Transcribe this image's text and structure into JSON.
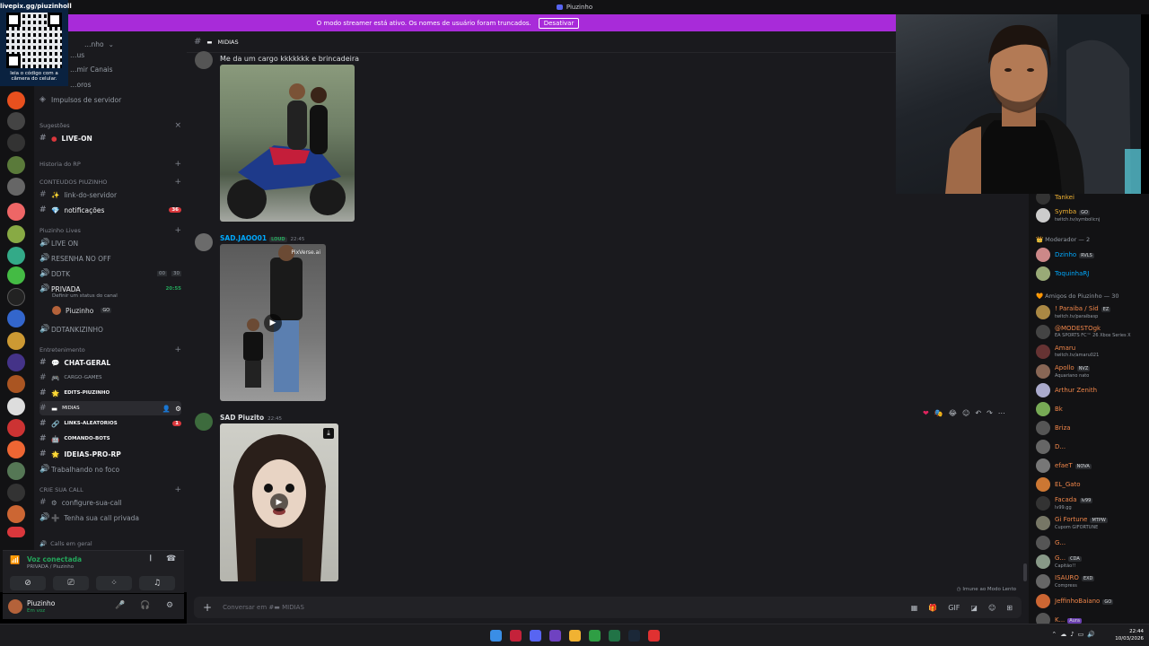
{
  "window": {
    "title": "Piuzinho"
  },
  "banner": {
    "text": "O modo streamer está ativo. Os nomes de usuário foram truncados.",
    "button": "Desativar"
  },
  "qr": {
    "url": "livepix.gg/piuzinholl",
    "caption": "leia o código com a câmera do celular."
  },
  "server": {
    "name": "…nho"
  },
  "channels": {
    "top_items": [
      "…us",
      "…mir Canais",
      "…oros",
      "Impulsos de servidor"
    ],
    "suggestions_label": "Sugestões",
    "live_on": "LIVE-ON",
    "cat_historia": "Historia do RP",
    "cat_conteudos": "CONTEUDOS PIUZINHO",
    "link_servidor": "link-do-servidor",
    "notificacoes": "notificações",
    "notif_badge": "36",
    "cat_lives": "Piuzinho Lives",
    "live_on_voice": "LIVE ON",
    "resenha": "RESENHA NO OFF",
    "ddtk": "DDTK",
    "ddtk_counts": [
      "00",
      "30"
    ],
    "privada": "PRIVADA",
    "privada_time": "20:55",
    "privada_status": "Definir um status do canal",
    "privada_user": "Piuzinho",
    "privada_user_tag": "GO",
    "ddtankzinho": "DDTANKIZINHO",
    "cat_entretenimento": "Entretenimento",
    "chat_geral": "CHAT-GERAL",
    "cargo_games": "CARGO-GAMES",
    "edits": "EDITS-PIUZINHO",
    "midias": "MIDIAS",
    "links": "LINKS-ALEATORIOS",
    "links_badge": "1",
    "comando": "COMANDO-BOTS",
    "ideias": "IDEIAS-PRO-RP",
    "trabalhando": "Trabalhando no foco",
    "cat_call": "CRIE SUA CALL",
    "configure": "configure-sua-call",
    "tenha": "Tenha sua call privada",
    "calls_geral": "Calls em geral"
  },
  "voice": {
    "status": "Voz conectada",
    "channel": "PRIVADA / Piuzinho"
  },
  "user": {
    "name": "Piuzinho",
    "status": "Em voz"
  },
  "header": {
    "channel": "MIDIAS"
  },
  "messages": [
    {
      "text": "Me da um cargo kkkkkkk e brincadeira"
    },
    {
      "author": "SAD.JAOO01",
      "tag": "LOUD",
      "time": "22:45",
      "watermark": "PixVerse.ai"
    },
    {
      "author": "SAD Piuzito",
      "time": "22:45"
    }
  ],
  "composer": {
    "placeholder": "Conversar em #",
    "channel": "MIDIAS"
  },
  "slowmode": "Imune ao Modo Lento",
  "members": {
    "top": [
      {
        "name": "Tankei",
        "color": "#f0b232"
      },
      {
        "name": "Symba",
        "tag": "GO",
        "sub": "twitch.tv/symbolicnj",
        "color": "#f0b232"
      }
    ],
    "mod_header": "Moderador — 2",
    "mods": [
      {
        "name": "Dzinho",
        "tag": "RVLS",
        "color": "#00a8fc"
      },
      {
        "name": "ToquinhaRJ",
        "color": "#00a8fc"
      }
    ],
    "friends_header": "Amigos do Piuzinho — 30",
    "friends": [
      {
        "name": "! Paraiba / Sid",
        "tag": "EZ",
        "sub": "twitch.tv/paraibasp"
      },
      {
        "name": "@MODESTOgk",
        "sub": "EA SPORTS FC™ 26 Xbox Series X"
      },
      {
        "name": "Amaru",
        "sub": "twitch.tv/amaru021"
      },
      {
        "name": "Apollo",
        "tag": "NVZ",
        "sub": "Aquariano nato"
      },
      {
        "name": "Arthur Zenith"
      },
      {
        "name": "Bk"
      },
      {
        "name": "Briza"
      },
      {
        "name": "D..."
      },
      {
        "name": "efaeT",
        "tag": "NOVA"
      },
      {
        "name": "EL_Gato"
      },
      {
        "name": "Facada",
        "tag": "lv99",
        "sub": "lv99.gg"
      },
      {
        "name": "Gi Fortune",
        "tag": "MTPW",
        "sub": "Cupom GIFORTUNE"
      },
      {
        "name": "G..."
      },
      {
        "name": "G...",
        "tag": "CDA",
        "sub": "Capitão!!"
      },
      {
        "name": "ISAURO",
        "tag": "EXD",
        "sub": "Compress"
      },
      {
        "name": "JeffinhoBaiano",
        "tag": "GO"
      },
      {
        "name": "K...",
        "tag": "Aura"
      }
    ]
  },
  "taskbar": {
    "time": "22:44",
    "date": "10/03/2026"
  },
  "colors": {
    "banner": "#a82bd9",
    "accent": "#5865f2",
    "online": "#23a55a",
    "badge": "#da373c",
    "friend_name": "#f0864a"
  }
}
